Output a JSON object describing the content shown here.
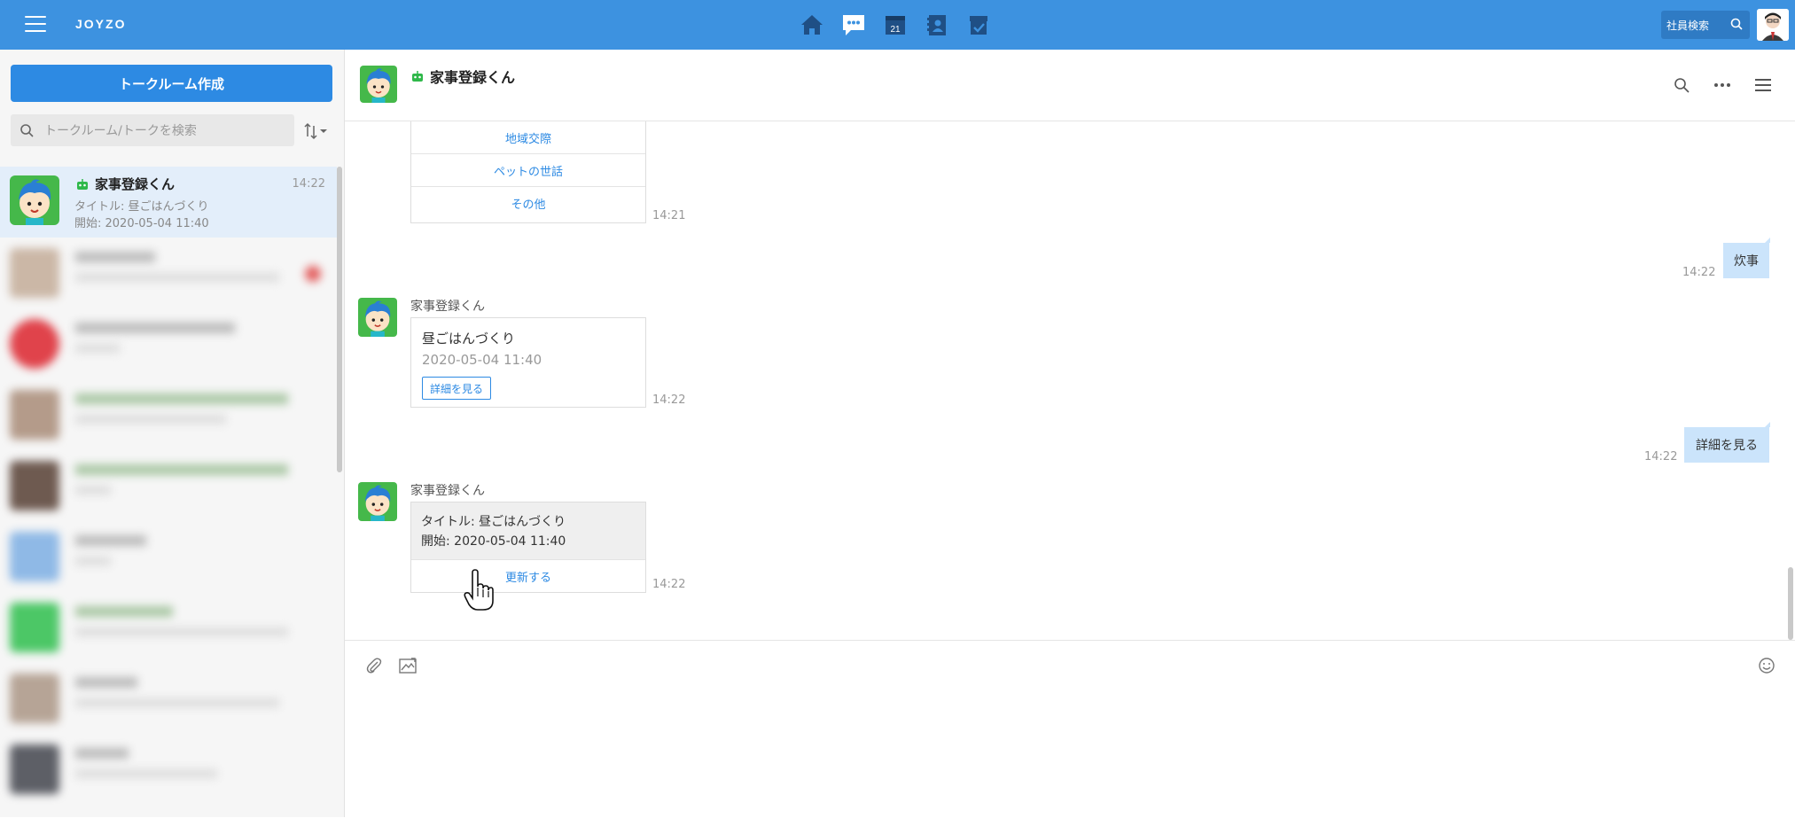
{
  "topbar": {
    "logo": "JOYZO",
    "apps": [
      "home-icon",
      "chat-icon",
      "calendar-icon",
      "contacts-icon",
      "task-icon"
    ],
    "calendar_day": "21",
    "employee_search_label": "社員検索",
    "accent": "#3d92e0"
  },
  "sidebar": {
    "create_button": "トークルーム作成",
    "search_placeholder": "トークルーム/トークを検索",
    "active_room": {
      "name": "家事登録くん",
      "time": "14:22",
      "line1": "タイトル: 昼ごはんづくり",
      "line2": "開始: 2020-05-04 11:40"
    }
  },
  "chat": {
    "title": "家事登録くん",
    "menu_options": [
      "地域交際",
      "ペットの世話",
      "その他"
    ],
    "menu_time": "14:21",
    "user_msg_1": {
      "text": "炊事",
      "time": "14:22"
    },
    "bot_msg_1": {
      "sender": "家事登録くん",
      "title": "昼ごはんづくり",
      "date": "2020-05-04 11:40",
      "button": "詳細を見る",
      "time": "14:22"
    },
    "user_msg_2": {
      "text": "詳細を見る",
      "time": "14:22"
    },
    "bot_msg_2": {
      "sender": "家事登録くん",
      "line1": "タイトル: 昼ごはんづくり",
      "line2": "開始: 2020-05-04 11:40",
      "action": "更新する",
      "time": "14:22"
    }
  },
  "composer": {
    "icons": [
      "attachment-icon",
      "image-icon",
      "emoji-icon"
    ]
  }
}
